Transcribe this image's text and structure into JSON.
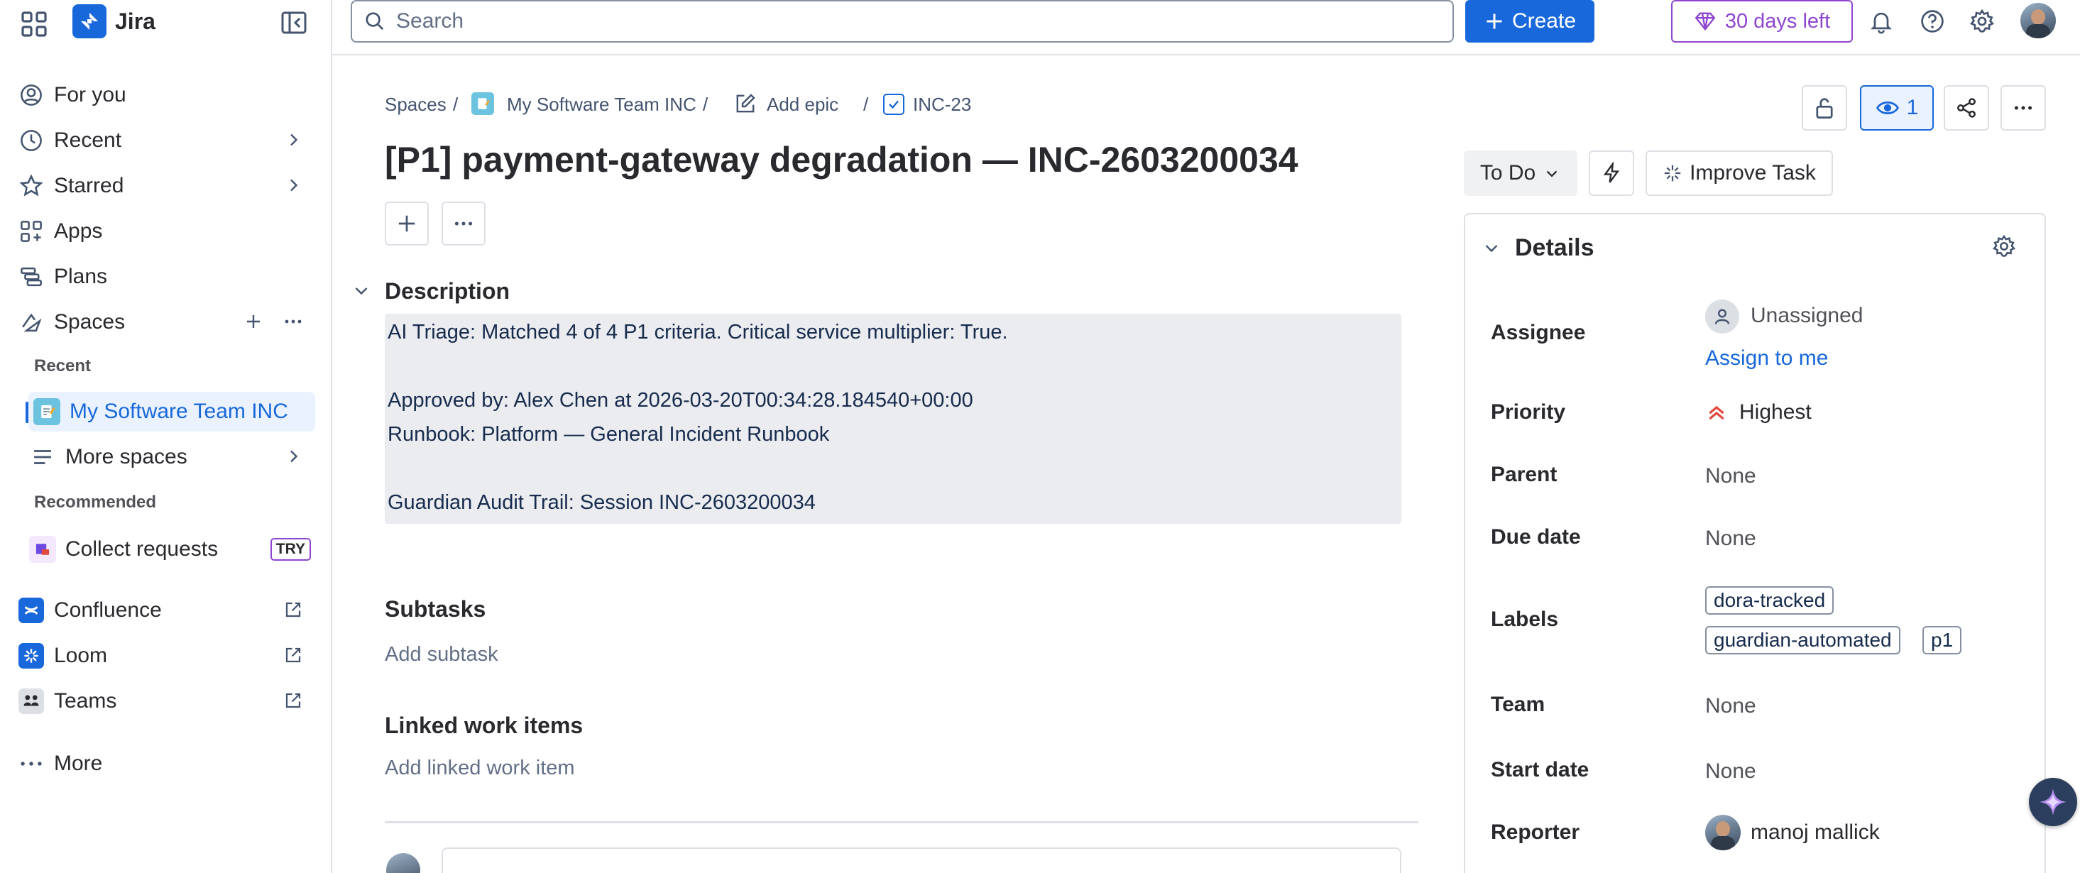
{
  "app": {
    "name": "Jira"
  },
  "sidebar": {
    "for_you": "For you",
    "recent": "Recent",
    "starred": "Starred",
    "apps": "Apps",
    "plans": "Plans",
    "spaces": "Spaces",
    "recent_section": "Recent",
    "my_team": "My Software Team INC",
    "more_spaces": "More spaces",
    "recommended_section": "Recommended",
    "collect_requests": "Collect requests",
    "try_badge": "TRY",
    "confluence": "Confluence",
    "loom": "Loom",
    "teams": "Teams",
    "more": "More"
  },
  "topbar": {
    "search_placeholder": "Search",
    "create_label": "Create",
    "trial_label": "30 days left"
  },
  "breadcrumb": {
    "spaces": "Spaces",
    "team": "My Software Team INC",
    "add_epic": "Add epic",
    "issue_key": "INC-23"
  },
  "issue": {
    "title": "[P1] payment-gateway degradation — INC-2603200034",
    "description_heading": "Description",
    "description_lines": [
      "AI Triage: Matched 4 of 4 P1 criteria. Critical service multiplier: True.",
      "Approved by: Alex Chen at 2026-03-20T00:34:28.184540+00:00",
      "Runbook: Platform — General Incident Runbook",
      "Guardian Audit Trail: Session INC-2603200034"
    ],
    "subtasks_heading": "Subtasks",
    "add_subtask": "Add subtask",
    "linked_heading": "Linked work items",
    "add_linked": "Add linked work item"
  },
  "actions": {
    "watch_count": "1",
    "status": "To Do",
    "improve": "Improve Task"
  },
  "details": {
    "heading": "Details",
    "assignee_label": "Assignee",
    "assignee_value": "Unassigned",
    "assign_to_me": "Assign to me",
    "priority_label": "Priority",
    "priority_value": "Highest",
    "parent_label": "Parent",
    "parent_value": "None",
    "due_label": "Due date",
    "due_value": "None",
    "labels_label": "Labels",
    "labels": [
      "dora-tracked",
      "guardian-automated",
      "p1"
    ],
    "team_label": "Team",
    "team_value": "None",
    "start_label": "Start date",
    "start_value": "None",
    "reporter_label": "Reporter",
    "reporter_value": "manoj mallick"
  },
  "colors": {
    "brand": "#1868db",
    "trial": "#8f46d1",
    "priority": "#e2483d"
  }
}
